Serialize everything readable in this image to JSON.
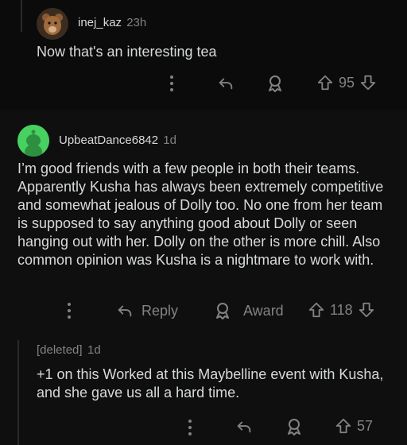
{
  "comments": [
    {
      "username": "inej_kaz",
      "time": "23h",
      "text": "Now that's an interesting tea",
      "votes": "95"
    },
    {
      "username": "UpbeatDance6842",
      "time": "1d",
      "text": "I’m good friends with a few people in both their teams. Apparently Kusha has always been extremely competitive and somewhat jealous of Dolly too. No one from her team is supposed to say anything good about Dolly or seen hanging out with her. Dolly on the other is more chill. Also common opinion was Kusha is a nightmare to work with.",
      "reply_label": "Reply",
      "award_label": "Award",
      "votes": "118"
    },
    {
      "username": "[deleted]",
      "time": "1d",
      "text": "+1 on this Worked at this Maybelline event with Kusha, and she gave us all a hard time.",
      "votes": "57"
    }
  ],
  "colors": {
    "background": "#000000",
    "text": "#d7dadc",
    "muted": "#818384",
    "avatar_green": "#46d160"
  },
  "icons": [
    "more-icon",
    "reply-icon",
    "award-icon",
    "upvote-icon",
    "downvote-icon"
  ]
}
